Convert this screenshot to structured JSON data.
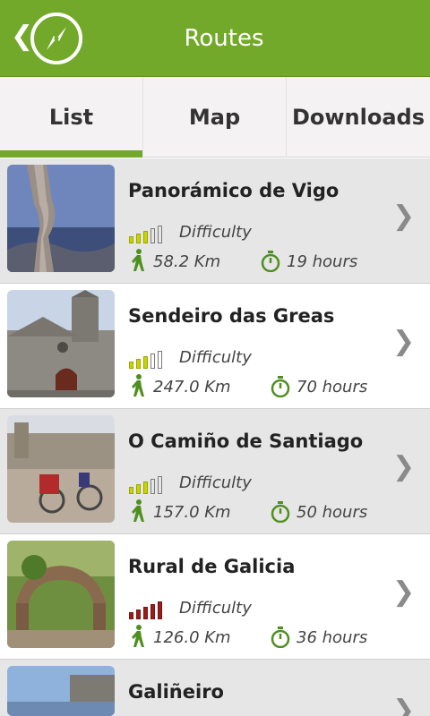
{
  "header": {
    "title": "Routes",
    "back_icon": "chevron-left-icon",
    "logo_icon": "compass-icon"
  },
  "tabs": [
    {
      "label": "List",
      "selected": true
    },
    {
      "label": "Map",
      "selected": false
    },
    {
      "label": "Downloads",
      "selected": false
    }
  ],
  "colors": {
    "accent": "#73a92a",
    "difficulty_easy": "#c9d400",
    "difficulty_hard": "#9b1b1b",
    "icon_green": "#4f8f1f"
  },
  "routes": [
    {
      "name": "Panorámico de Vigo",
      "difficulty_label": "Difficulty",
      "difficulty_level": 3,
      "difficulty_max": 5,
      "difficulty_color": "#c9d400",
      "distance": "58.2 Km",
      "duration": "19 hours"
    },
    {
      "name": "Sendeiro das Greas",
      "difficulty_label": "Difficulty",
      "difficulty_level": 3,
      "difficulty_max": 5,
      "difficulty_color": "#c9d400",
      "distance": "247.0 Km",
      "duration": "70 hours"
    },
    {
      "name": "O Camiño de Santiago",
      "difficulty_label": "Difficulty",
      "difficulty_level": 3,
      "difficulty_max": 5,
      "difficulty_color": "#c9d400",
      "distance": "157.0 Km",
      "duration": "50 hours"
    },
    {
      "name": "Rural de Galicia",
      "difficulty_label": "Difficulty",
      "difficulty_level": 5,
      "difficulty_max": 5,
      "difficulty_color": "#9b1b1b",
      "distance": "126.0 Km",
      "duration": "36 hours"
    },
    {
      "name": "Galiñeiro",
      "difficulty_label": "",
      "difficulty_level": 0,
      "difficulty_max": 5,
      "difficulty_color": "#c9d400",
      "distance": "",
      "duration": ""
    }
  ]
}
